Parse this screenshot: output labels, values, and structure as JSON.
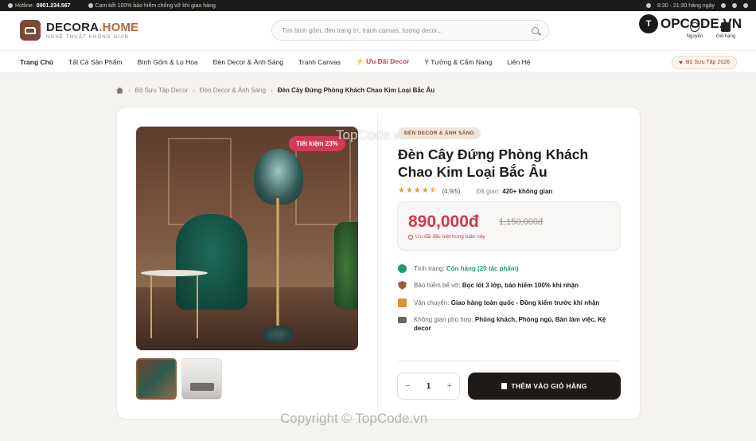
{
  "topbar": {
    "hotline_label": "Hotline:",
    "hotline_number": "0901.234.567",
    "commitment": "Cam kết 100% bảo hiểm chống vỡ khi giao hàng",
    "hours": "8:30 - 21:30 hàng ngày"
  },
  "header": {
    "logo_name_1": "DECORA",
    "logo_name_2": ".HOME",
    "logo_tagline": "NGHỆ THUẬT KHÔNG GIAN",
    "search_placeholder": "Tìm bình gốm, đèn trang trí, tranh canvas, tượng decor...",
    "account_label": "Nguyễn",
    "cart_label": "Giỏ hàng",
    "watermark_brand_1": "T",
    "watermark_brand_2": "OPCODE.VN"
  },
  "nav": {
    "items": [
      {
        "label": "Trang Chủ"
      },
      {
        "label": "Tất Cả Sản Phẩm"
      },
      {
        "label": "Bình Gốm & Lọ Hoa"
      },
      {
        "label": "Đèn Decor & Ánh Sáng"
      },
      {
        "label": "Tranh Canvas"
      },
      {
        "label": "Ưu Đãi Decor"
      },
      {
        "label": "Ý Tưởng & Cẩm Nang"
      },
      {
        "label": "Liên Hệ"
      }
    ],
    "collection_label": "Bộ Sưu Tập 2026"
  },
  "breadcrumb": {
    "items": [
      "Bộ Sưu Tập Decor",
      "Đèn Decor & Ánh Sáng"
    ],
    "current": "Đèn Cây Đứng Phòng Khách Chao Kim Loại Bắc Âu"
  },
  "product": {
    "save_badge": "Tiết kiệm 23%",
    "category_tag": "ĐÈN DECOR & ÁNH SÁNG",
    "title": "Đèn Cây Đứng Phòng Khách Chao Kim Loại Bắc Âu",
    "rating_stars": 4.9,
    "rating_text": "(4.9/5)",
    "sold_label": "Đã giao:",
    "sold_value": "420+ không gian",
    "price": "890,000đ",
    "old_price": "1,150,000đ",
    "promo_note": "Ưu đãi đặc biệt trong tuần này",
    "stock_label": "Tình trạng:",
    "stock_value": "Còn hàng (20 tác phẩm)",
    "insurance_label": "Bảo hiểm bể vỡ:",
    "insurance_value": "Bọc lót 3 lớp, bảo hiểm 100% khi nhận",
    "shipping_label": "Vận chuyển:",
    "shipping_value": "Giao hàng toàn quốc - Đồng kiểm trước khi nhận",
    "space_label": "Không gian phù hợp:",
    "space_value": "Phòng khách, Phòng ngủ, Bàn làm việc, Kệ decor",
    "quantity": "1",
    "qty_minus": "−",
    "qty_plus": "+",
    "add_to_cart": "THÊM VÀO GIỎ HÀNG"
  },
  "watermarks": {
    "image": "TopCode.vn",
    "footer": "Copyright © TopCode.vn"
  },
  "colors": {
    "accent": "#d0384f",
    "brand": "#7a4a36",
    "dark": "#1e1a17",
    "success": "#1f9d6b"
  }
}
